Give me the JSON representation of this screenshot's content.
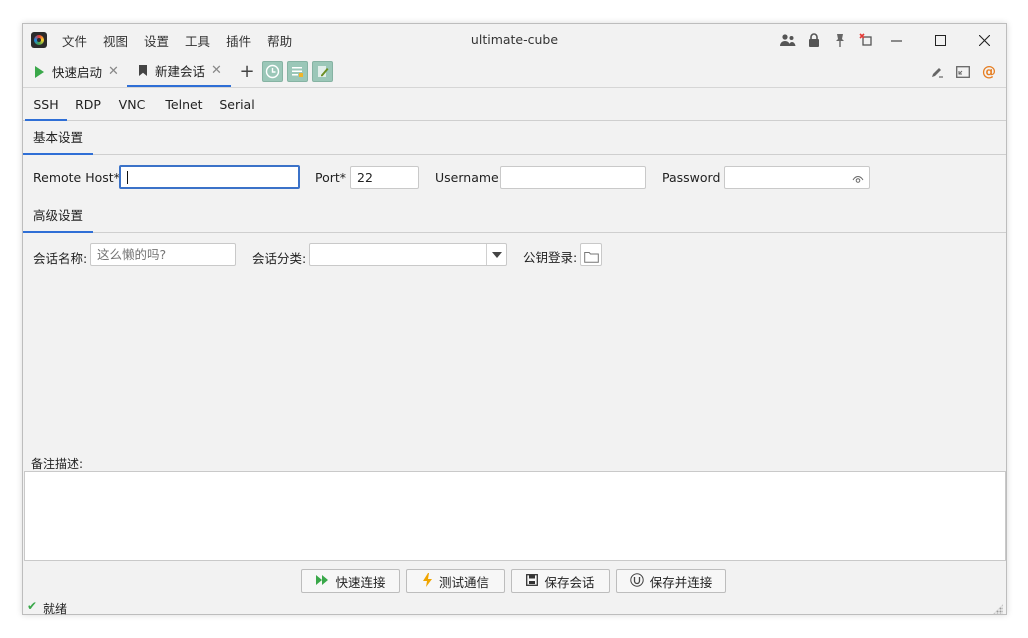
{
  "window": {
    "title": "ultimate-cube"
  },
  "menu": [
    "文件",
    "视图",
    "设置",
    "工具",
    "插件",
    "帮助"
  ],
  "tabs": [
    {
      "label": "快速启动",
      "icon": "play-icon"
    },
    {
      "label": "新建会话",
      "icon": "bookmark-icon"
    }
  ],
  "protocols": [
    "SSH",
    "RDP",
    "VNC",
    "Telnet",
    "Serial"
  ],
  "basic": {
    "header": "基本设置",
    "remote_host_label": "Remote Host*",
    "remote_host_value": "",
    "port_label": "Port*",
    "port_value": "22",
    "username_label": "Username",
    "username_value": "",
    "password_label": "Password",
    "password_value": ""
  },
  "advanced": {
    "header": "高级设置",
    "session_name_label": "会话名称:",
    "session_name_placeholder": "这么懒的吗?",
    "category_label": "会话分类:",
    "category_value": "",
    "pubkey_label": "公钥登录:"
  },
  "notes": {
    "label": "备注描述:",
    "value": ""
  },
  "buttons": {
    "quick_connect": "快速连接",
    "test_connection": "测试通信",
    "save_session": "保存会话",
    "save_and_connect": "保存并连接"
  },
  "status": {
    "text": "就绪"
  },
  "colors": {
    "accent": "#2f6fd6",
    "ok": "#3aa84a",
    "toolbar_button": "#9bc7b8",
    "at_icon": "#e67e22"
  }
}
